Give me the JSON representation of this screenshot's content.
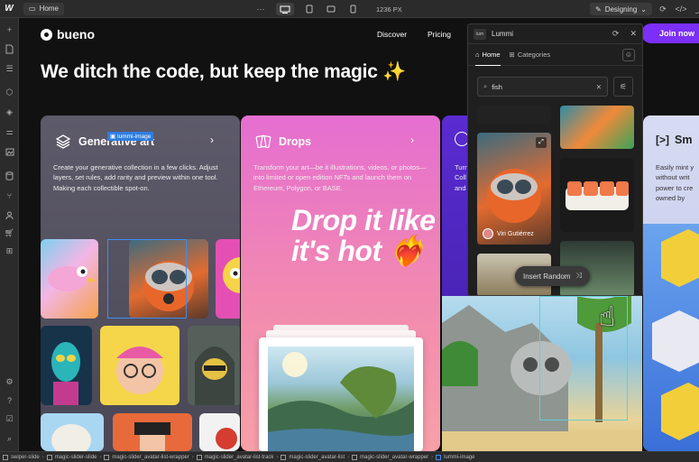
{
  "topbar": {
    "page_label": "Home",
    "width_label": "1236 PX",
    "mode_label": "Designing"
  },
  "site": {
    "brand": "bueno",
    "nav": [
      "Discover",
      "Pricing"
    ],
    "cta": "Join now",
    "hero_title": "We ditch the code, but keep the magic ✨"
  },
  "cards": {
    "generative": {
      "title": "Generative art",
      "desc": "Create your generative collection in a few clicks. Adjust layers, set rules, add rarity and preview within one tool. Making each collectible spot-on."
    },
    "drops": {
      "title": "Drops",
      "desc": "Transform your art—be it illustrations, videos, or photos—into limited or open edition NFTs and launch them on Ethereum, Polygon, or BASE.",
      "big_text": "Drop it like it's hot",
      "emoji": "❤️‍🔥"
    },
    "purple": {
      "desc_lines": [
        "Turn",
        "Coll",
        "and"
      ]
    },
    "smart": {
      "title": "Sm",
      "desc_lines": [
        "Easily mint y",
        "without writ",
        "power to cre",
        "owned by"
      ]
    }
  },
  "selection": {
    "tag": "lummi-image"
  },
  "lummi": {
    "title": "Lummi",
    "logo": "lum",
    "tabs": [
      "Home",
      "Categories"
    ],
    "search_value": "fish",
    "author": "Viri Gutiérrez",
    "insert_random": "Insert Random"
  },
  "breadcrumbs": [
    "swiper-slide",
    "magic-slider-slide",
    "magic-slider_avatar-list-wrapper",
    "magic-slider_avatar-list-track",
    "magic-slider_avatar-list",
    "magic-slider_avatar-wrapper",
    "lummi-image"
  ],
  "colors": {
    "accent": "#7b2ff7",
    "selection": "#2f7de1",
    "canvas_bg": "#111111"
  }
}
